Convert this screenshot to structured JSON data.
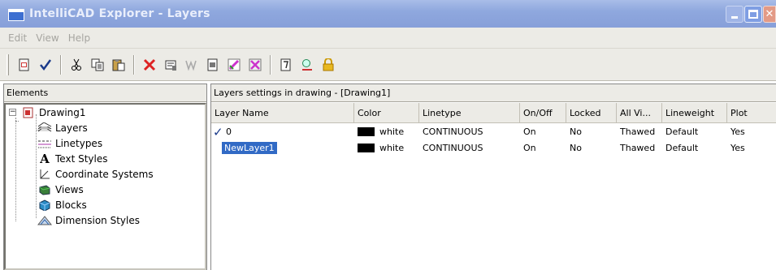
{
  "window": {
    "title": "IntelliCAD Explorer - Layers"
  },
  "menu": [
    "Edit",
    "View",
    "Help"
  ],
  "colors": {
    "selection": "#316ac5",
    "titlebar": "#8fa8de",
    "chrome": "#ecebe6"
  },
  "toolbar": {
    "icons": [
      "new-item-icon",
      "check-icon",
      "cut-icon",
      "copy-icon",
      "paste-icon",
      "delete-icon",
      "properties-icon",
      "purge-icon",
      "regen-icon",
      "layer-edit-icon",
      "layer-filter-icon",
      "view-icon",
      "find-icon",
      "lock-icon"
    ]
  },
  "left_panel": {
    "header": "Elements",
    "root": "Drawing1",
    "items": [
      {
        "label": "Layers",
        "icon": "layers-icon"
      },
      {
        "label": "Linetypes",
        "icon": "linetypes-icon"
      },
      {
        "label": "Text Styles",
        "icon": "text-styles-icon"
      },
      {
        "label": "Coordinate Systems",
        "icon": "coordinate-systems-icon"
      },
      {
        "label": "Views",
        "icon": "views-icon"
      },
      {
        "label": "Blocks",
        "icon": "blocks-icon"
      },
      {
        "label": "Dimension Styles",
        "icon": "dimension-styles-icon"
      }
    ]
  },
  "right_panel": {
    "header": "Layers settings in drawing - [Drawing1]",
    "columns": [
      "Layer Name",
      "Color",
      "Linetype",
      "On/Off",
      "Locked",
      "All Vi...",
      "Lineweight",
      "Plot"
    ],
    "rows": [
      {
        "name": "0",
        "current": true,
        "color": "white",
        "linetype": "CONTINUOUS",
        "onoff": "On",
        "locked": "No",
        "viewports": "Thawed",
        "lineweight": "Default",
        "plot": "Yes"
      },
      {
        "name": "NewLayer1",
        "current": false,
        "color": "white",
        "linetype": "CONTINUOUS",
        "onoff": "On",
        "locked": "No",
        "viewports": "Thawed",
        "lineweight": "Default",
        "plot": "Yes"
      }
    ]
  }
}
